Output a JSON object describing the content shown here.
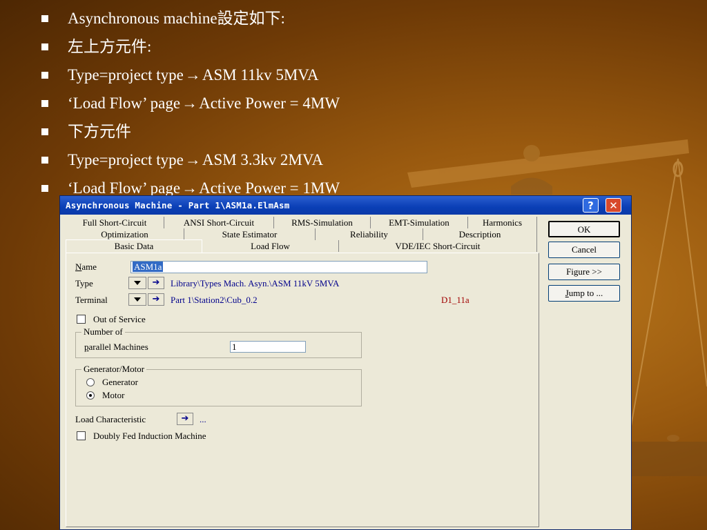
{
  "slide": {
    "bullets": [
      {
        "text": "Asynchronous machine設定如下:"
      },
      {
        "text": "左上方元件:"
      },
      {
        "before": "Type=project type ",
        "arrow": "→",
        "after": "ASM 11kv 5MVA"
      },
      {
        "before": "‘Load Flow’ page ",
        "arrow": "→",
        "after": "Active Power = 4MW"
      },
      {
        "text": "下方元件"
      },
      {
        "before": "Type=project type ",
        "arrow": "→",
        "after": "ASM 3.3kv 2MVA"
      },
      {
        "before": "‘Load Flow’ page ",
        "arrow": "→",
        "after": "Active Power = 1MW"
      }
    ]
  },
  "dialog": {
    "title": "Asynchronous Machine - Part 1\\ASM1a.ElmAsm",
    "help": "?",
    "close": "✕",
    "tabs": {
      "row1": [
        "Full Short-Circuit",
        "ANSI Short-Circuit",
        "RMS-Simulation",
        "EMT-Simulation",
        "Harmonics"
      ],
      "row2": [
        "Optimization",
        "State Estimator",
        "Reliability",
        "Description"
      ],
      "row3": [
        "Basic Data",
        "Load Flow",
        "VDE/IEC Short-Circuit"
      ],
      "active": "Basic Data"
    },
    "name_label_u": "N",
    "name_label_rest": "ame",
    "name_value": "ASM1a",
    "type_label": "Type",
    "type_value": "Library\\Types Mach. Asyn.\\ASM 11kV 5MVA",
    "terminal_label": "Terminal",
    "terminal_value": "Part 1\\Station2\\Cub_0.2",
    "terminal_extra": "D1_11a",
    "out_of_service": "Out of Service",
    "number_of_group": "Number of",
    "parallel_label_u": "p",
    "parallel_label_rest": "arallel Machines",
    "parallel_value": "1",
    "gen_motor_group": "Generator/Motor",
    "generator": "Generator",
    "motor": "Motor",
    "mode_selected": "Motor",
    "load_characteristic": "Load Characteristic",
    "load_char_value": "...",
    "doubly_fed": "Doubly Fed Induction Machine",
    "buttons": {
      "ok": "OK",
      "cancel": "Cancel",
      "figure": "Figure >>",
      "jump_u": "J",
      "jump_rest": "ump to ..."
    },
    "arrow_glyph": "➔"
  },
  "colors": {
    "title_bar": "#0a3fb6",
    "dialog_bg": "#ece9d8",
    "link_blue": "#00008b",
    "terminal_red": "#a00000",
    "background": "#9a5a0f"
  }
}
